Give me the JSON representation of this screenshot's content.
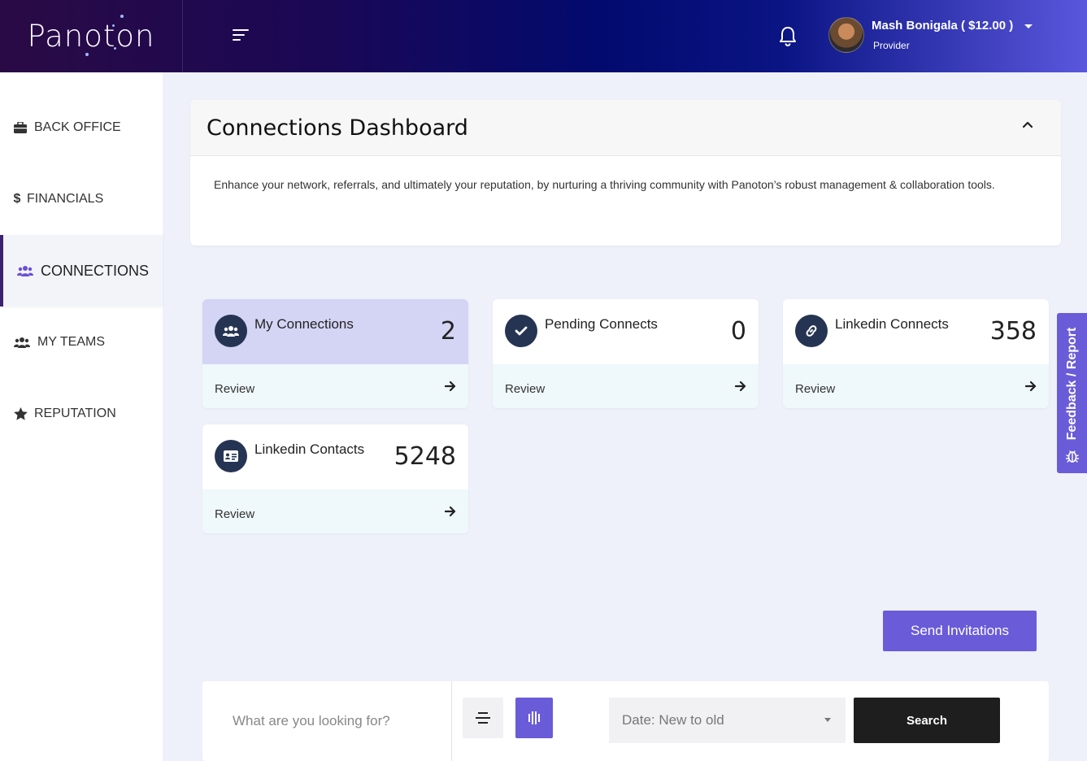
{
  "header": {
    "logo": "Panoton",
    "user_name": "Mash Bonigala ( $12.00 )",
    "user_role": "Provider"
  },
  "sidebar": {
    "items": [
      {
        "label": "BACK OFFICE",
        "icon": "briefcase-icon"
      },
      {
        "label": "FINANCIALS",
        "icon": "dollar-icon"
      },
      {
        "label": "CONNECTIONS",
        "icon": "users-icon",
        "active": true
      },
      {
        "label": "MY TEAMS",
        "icon": "users-icon"
      },
      {
        "label": "REPUTATION",
        "icon": "star-icon"
      }
    ]
  },
  "dashboard": {
    "title": "Connections Dashboard",
    "description": "Enhance your network, referrals, and ultimately your reputation, by nurturing a thriving community with Panoton’s robust management & collaboration tools."
  },
  "cards": [
    {
      "title": "My Connections",
      "count": "2",
      "review": "Review",
      "icon": "users-icon",
      "highlight": true
    },
    {
      "title": "Pending Connects",
      "count": "0",
      "review": "Review",
      "icon": "check-icon"
    },
    {
      "title": "Linkedin Connects",
      "count": "358",
      "review": "Review",
      "icon": "link-icon"
    },
    {
      "title": "Linkedin Contacts",
      "count": "5248",
      "review": "Review",
      "icon": "id-card-icon"
    }
  ],
  "actions": {
    "send_invitations": "Send Invitations"
  },
  "search": {
    "placeholder": "What are you looking for?",
    "sort_selected": "Date: New to old",
    "search_label": "Search"
  },
  "feedback": {
    "label": "Feedback / Report"
  },
  "colors": {
    "accent": "#6a5bd8",
    "card_icon": "#263453",
    "active_card": "#d4d5f5"
  }
}
